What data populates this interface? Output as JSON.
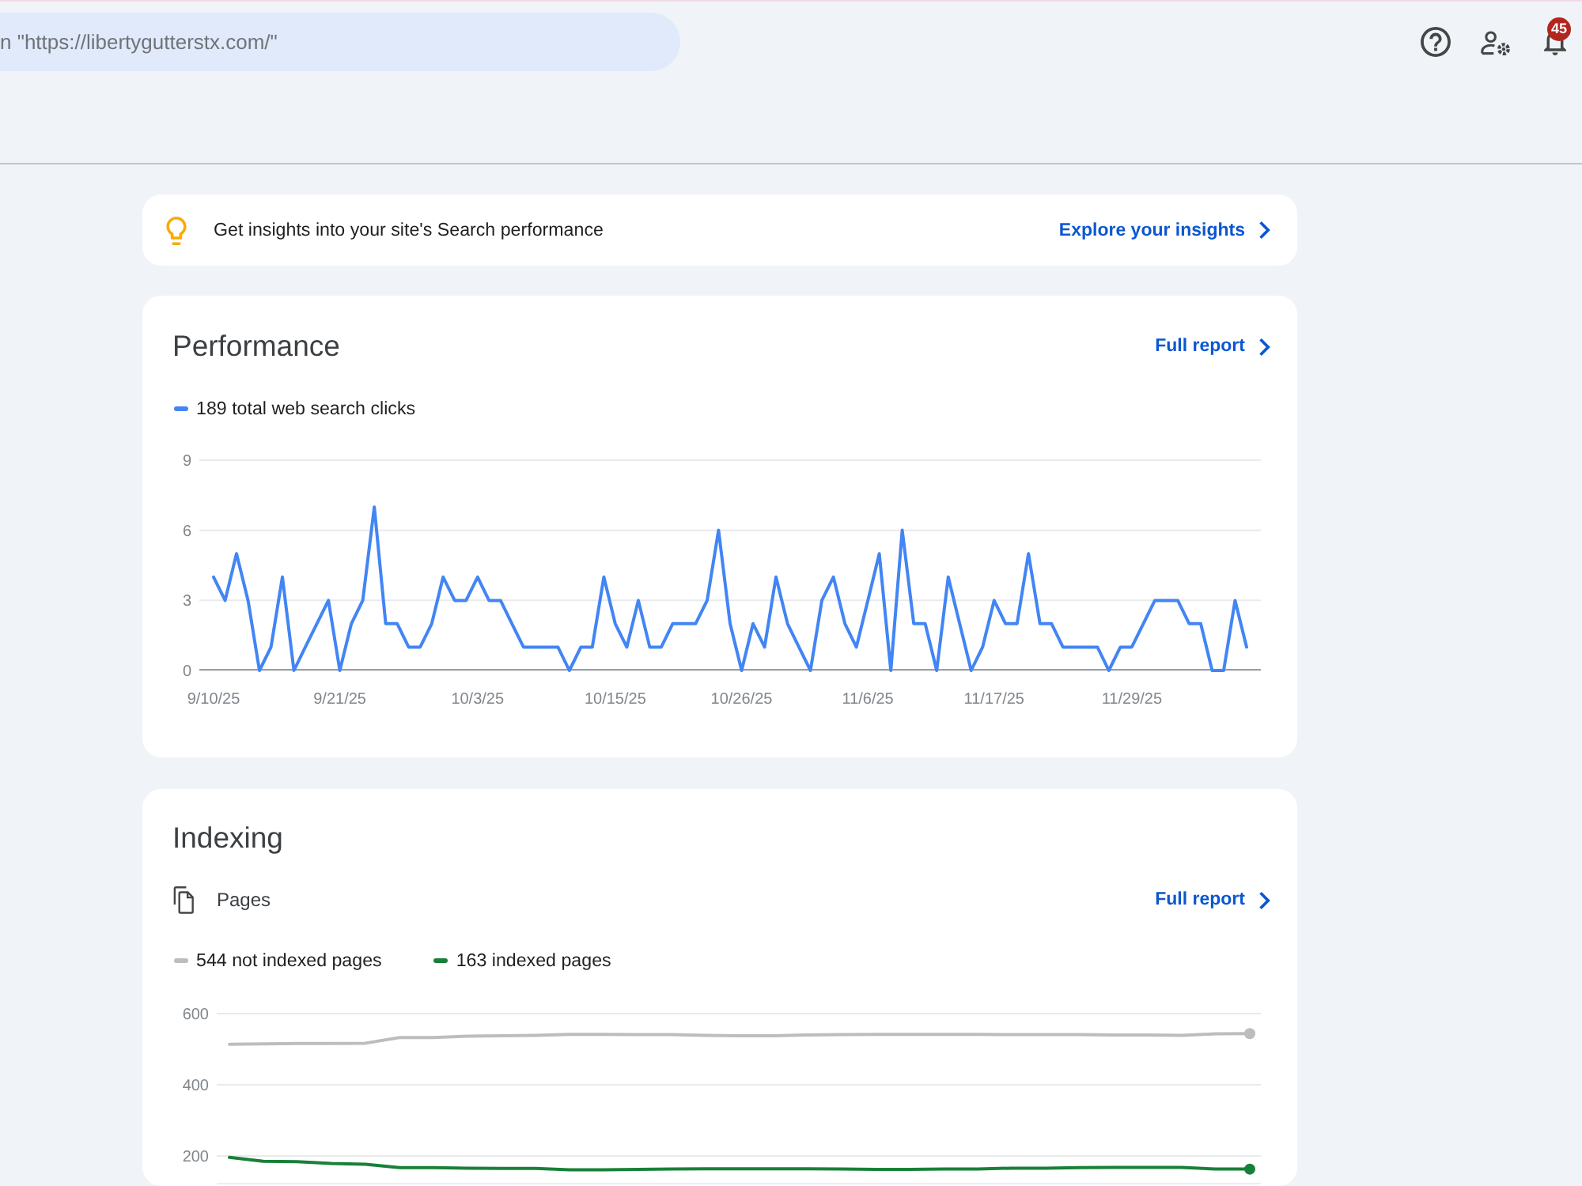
{
  "header": {
    "search": {
      "placeholder": "n \"https://libertygutterstx.com/\""
    },
    "notifications": {
      "badge": "45"
    }
  },
  "insights": {
    "text": "Get insights into your site's Search performance",
    "link": "Explore your insights"
  },
  "performance": {
    "title": "Performance",
    "link": "Full report",
    "chart_data": {
      "type": "line",
      "categories": [
        "9/10/25",
        null,
        null,
        null,
        null,
        null,
        null,
        null,
        null,
        null,
        null,
        "9/21/25",
        null,
        null,
        null,
        null,
        null,
        null,
        null,
        null,
        null,
        null,
        null,
        "10/3/25",
        null,
        null,
        null,
        null,
        null,
        null,
        null,
        null,
        null,
        null,
        null,
        "10/15/25",
        null,
        null,
        null,
        null,
        null,
        null,
        null,
        null,
        null,
        null,
        "10/26/25",
        null,
        null,
        null,
        null,
        null,
        null,
        null,
        null,
        null,
        null,
        "11/6/25",
        null,
        null,
        null,
        null,
        null,
        null,
        null,
        null,
        null,
        null,
        "11/17/25",
        null,
        null,
        null,
        null,
        null,
        null,
        null,
        null,
        null,
        null,
        null,
        "11/29/25",
        null,
        null,
        null,
        null,
        null,
        null,
        null,
        null,
        null,
        null
      ],
      "series": [
        {
          "name": "189 total web search clicks",
          "color": "#4285f4",
          "values": [
            4,
            3,
            5,
            3,
            0,
            1,
            4,
            0,
            1,
            2,
            3,
            0,
            2,
            3,
            7,
            2,
            2,
            1,
            1,
            2,
            4,
            3,
            3,
            4,
            3,
            3,
            2,
            1,
            1,
            1,
            1,
            0,
            1,
            1,
            4,
            2,
            1,
            3,
            1,
            1,
            2,
            2,
            2,
            3,
            6,
            2,
            0,
            2,
            1,
            4,
            2,
            1,
            0,
            3,
            4,
            2,
            1,
            3,
            5,
            0,
            6,
            2,
            2,
            0,
            4,
            2,
            0,
            1,
            3,
            2,
            2,
            5,
            2,
            2,
            1,
            1,
            1,
            1,
            0,
            1,
            1,
            2,
            3,
            3,
            3,
            2,
            2,
            0,
            0,
            3,
            1
          ]
        }
      ],
      "ylim": [
        0,
        9
      ],
      "yticks": [
        0,
        3,
        6,
        9
      ]
    }
  },
  "indexing": {
    "title": "Indexing",
    "section": "Pages",
    "link": "Full report",
    "chart_data": {
      "type": "line",
      "series": [
        {
          "name": "544 not indexed pages",
          "color": "#bdbdbd",
          "values": [
            514,
            515,
            516,
            516,
            517,
            533,
            533,
            537,
            538,
            539,
            542,
            542,
            541,
            541,
            539,
            538,
            538,
            540,
            541,
            542,
            542,
            542,
            542,
            541,
            541,
            541,
            540,
            540,
            539,
            543,
            544
          ]
        },
        {
          "name": "163 indexed pages",
          "color": "#188038",
          "values": [
            196,
            185,
            184,
            179,
            177,
            167,
            167,
            166,
            165,
            165,
            161,
            161,
            162,
            163,
            164,
            164,
            164,
            164,
            163,
            162,
            162,
            163,
            163,
            166,
            166,
            167,
            168,
            168,
            168,
            163,
            163
          ]
        }
      ],
      "ylim": [
        120,
        600
      ],
      "yticks": [
        200,
        400,
        600
      ]
    }
  }
}
